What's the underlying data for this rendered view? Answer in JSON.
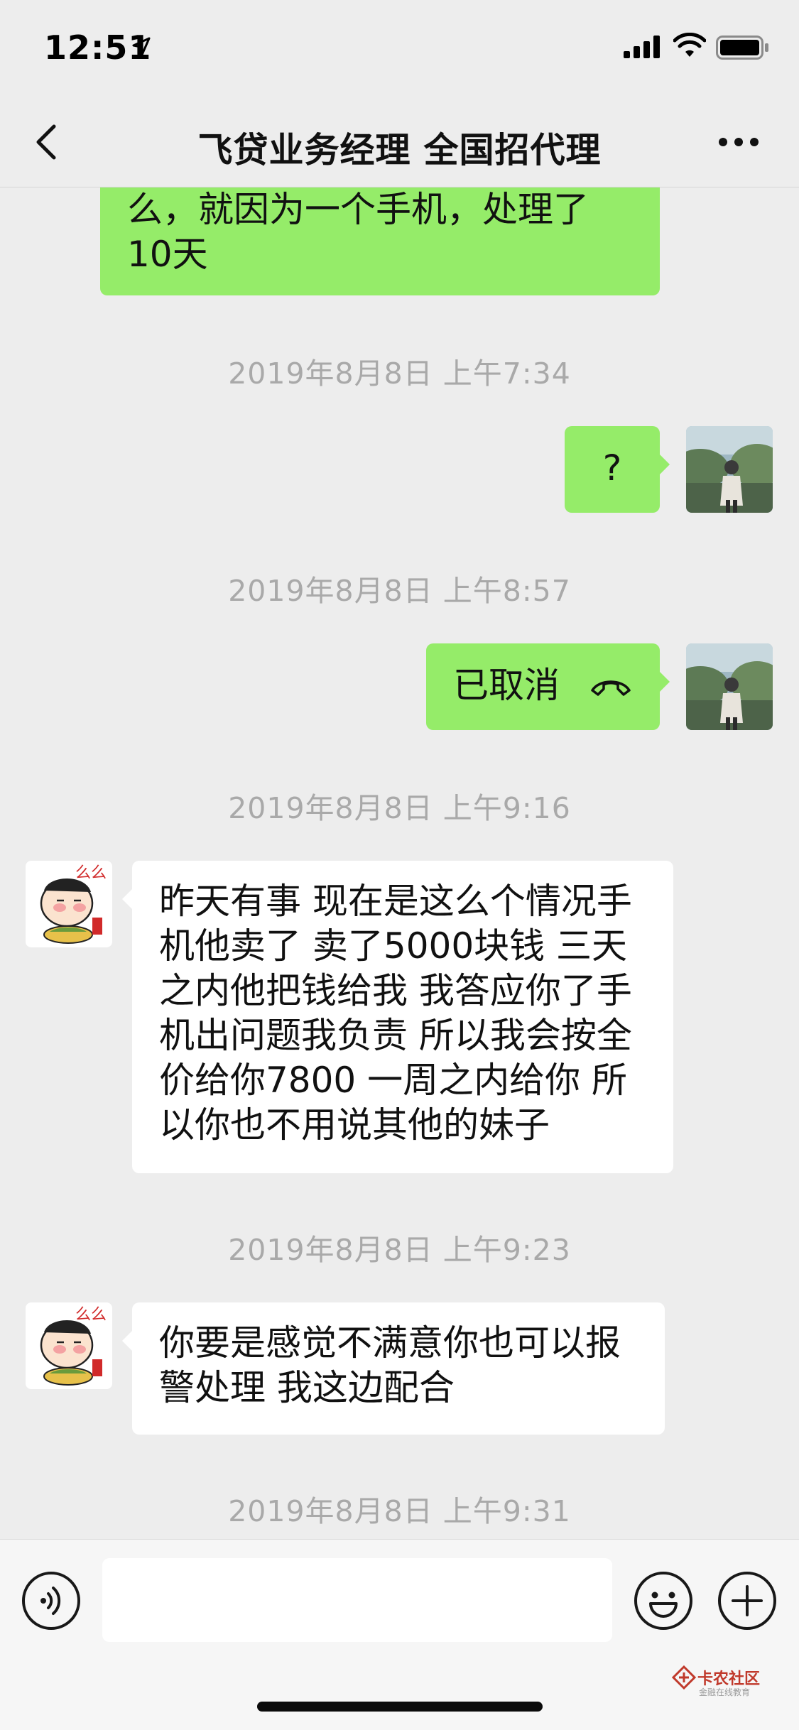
{
  "status_bar": {
    "time": "12:51"
  },
  "nav": {
    "title": "飞贷业务经理 全国招代理"
  },
  "messages": [
    {
      "side": "out",
      "lines": [
        "么，就因为一个手机，处理了",
        "10天"
      ]
    },
    {
      "timestamp": "2019年8月8日 上午7:34"
    },
    {
      "side": "out",
      "text": "?"
    },
    {
      "timestamp": "2019年8月8日 上午8:57"
    },
    {
      "side": "out",
      "text": "已取消",
      "icon": "call-ended-icon"
    },
    {
      "timestamp": "2019年8月8日 上午9:16"
    },
    {
      "side": "in",
      "lines": [
        "昨天有事 现在是这么个情况手",
        "机他卖了 卖了5000块钱 三天",
        "之内他把钱给我 我答应你了手",
        "机出问题我负责 所以我会按全",
        "价给你7800 一周之内给你 所",
        "以你也不用说其他的妹子"
      ]
    },
    {
      "timestamp": "2019年8月8日 上午9:23"
    },
    {
      "side": "in",
      "lines": [
        "你要是感觉不满意你也可以报",
        "警处理 我这边配合"
      ]
    },
    {
      "timestamp": "2019年8月8日 上午9:31"
    }
  ],
  "input_bar": {
    "placeholder": "",
    "value": ""
  },
  "watermark": {
    "title": "卡农社区",
    "subtitle": "金融在线教育"
  },
  "colors": {
    "outgoing_bubble": "#95ec69",
    "incoming_bubble": "#ffffff",
    "background": "#ededed",
    "timestamp_text": "#a9a9a9"
  }
}
